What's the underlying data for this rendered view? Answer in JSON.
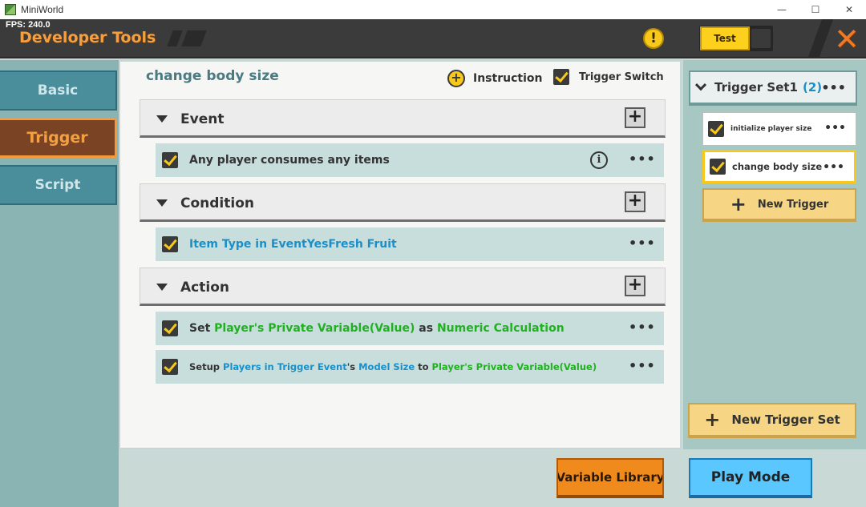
{
  "window": {
    "title": "MiniWorld",
    "controls": {
      "minimize": "—",
      "maximize": "☐",
      "close": "✕"
    }
  },
  "header": {
    "fps": "FPS: 240.0",
    "title": "Developer Tools",
    "warning_icon": "!",
    "test_label": "Test",
    "close_glyph": "✕"
  },
  "nav": {
    "items": [
      {
        "label": "Basic",
        "active": false
      },
      {
        "label": "Trigger",
        "active": true
      },
      {
        "label": "Script",
        "active": false
      }
    ]
  },
  "editor": {
    "trigger_name": "change body size",
    "instruction_label": "Instruction",
    "trigger_switch_label": "Trigger Switch",
    "sections": {
      "event": {
        "label": "Event",
        "items": [
          {
            "segments": [
              {
                "text": "Any player consumes any items",
                "color": "default"
              }
            ]
          }
        ]
      },
      "condition": {
        "label": "Condition",
        "items": [
          {
            "segments": [
              {
                "text": "Item Type in EventYesFresh Fruit",
                "color": "blue"
              }
            ]
          }
        ]
      },
      "action": {
        "label": "Action",
        "items": [
          {
            "segments": [
              {
                "text": "Set ",
                "color": "default"
              },
              {
                "text": "Player's Private Variable(Value)",
                "color": "green"
              },
              {
                "text": " as ",
                "color": "default"
              },
              {
                "text": "Numeric Calculation",
                "color": "green"
              }
            ]
          },
          {
            "segments": [
              {
                "text": "Setup ",
                "color": "default"
              },
              {
                "text": "Players in Trigger Event",
                "color": "blue"
              },
              {
                "text": "'s ",
                "color": "default"
              },
              {
                "text": "Model Size",
                "color": "blue"
              },
              {
                "text": " to ",
                "color": "default"
              },
              {
                "text": "Player's Private Variable(Value)",
                "color": "green"
              }
            ]
          }
        ]
      }
    },
    "add_glyph": "+",
    "more_glyph": "•••",
    "info_glyph": "i"
  },
  "trigger_panel": {
    "set_label": "Trigger Set1",
    "set_count": "(2)",
    "triggers": [
      {
        "label": "initialize player size",
        "selected": false
      },
      {
        "label": "change body size",
        "selected": true
      }
    ],
    "new_trigger_label": "New Trigger",
    "new_trigger_set_label": "New Trigger Set"
  },
  "bottom": {
    "variable_library_label": "Variable Library",
    "play_mode_label": "Play Mode"
  },
  "colors": {
    "accent_orange": "#f4a040",
    "text_blue": "#1a8fc8",
    "text_green": "#20b020",
    "check_yellow": "#f8c81a"
  }
}
